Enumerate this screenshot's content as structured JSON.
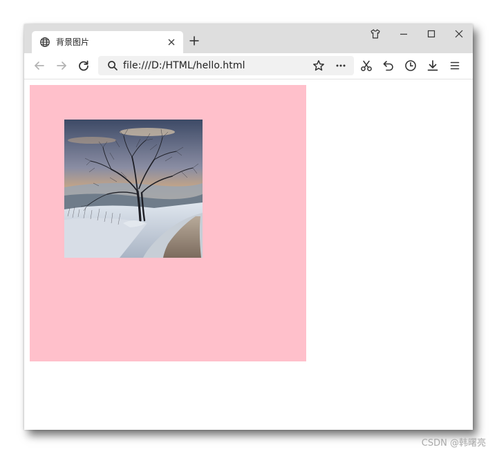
{
  "browser": {
    "tab": {
      "title": "背景图片"
    },
    "address_bar": {
      "url": "file:///D:/HTML/hello.html"
    }
  },
  "page": {
    "box_color": "#ffc0cb",
    "image_icon": "winter-tree-landscape"
  },
  "watermark": {
    "text": "CSDN @韩曙亮"
  }
}
